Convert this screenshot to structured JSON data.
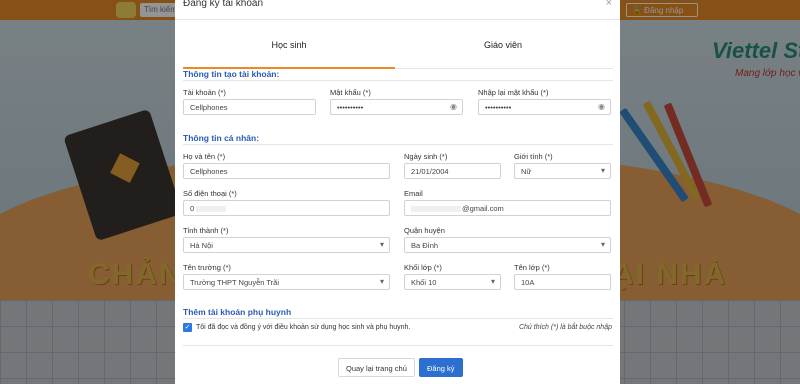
{
  "background": {
    "search_placeholder": "Tìm kiếm",
    "login_label": "🔒 Đăng nhập",
    "brand": "Viettel St",
    "slogan": "Mang lớp học về",
    "big_text_left": "CHẢN",
    "big_text_right": "ẠI NHÀ"
  },
  "modal": {
    "title": "Đăng ký tài khoản",
    "close_glyph": "×",
    "tabs": [
      {
        "label": "Học sinh",
        "active": true
      },
      {
        "label": "Giáo viên",
        "active": false
      }
    ],
    "account_section": {
      "heading": "Thông tin tạo tài khoản:",
      "username_label": "Tài khoản (*)",
      "username_value": "Cellphones",
      "password_label": "Mật khẩu (*)",
      "password_value": "••••••••••",
      "confirm_label": "Nhập lại mật khẩu (*)",
      "confirm_value": "••••••••••"
    },
    "personal_section": {
      "heading": "Thông tin cá nhân:",
      "fullname_label": "Họ và tên (*)",
      "fullname_value": "Cellphones",
      "dob_label": "Ngày sinh (*)",
      "dob_value": "21/01/2004",
      "gender_label": "Giới tính (*)",
      "gender_value": "Nữ",
      "phone_label": "Số điện thoại (*)",
      "phone_value": "0",
      "email_label": "Email",
      "email_value": "@gmail.com",
      "province_label": "Tỉnh thành (*)",
      "province_value": "Hà Nội",
      "district_label": "Quận huyện",
      "district_value": "Ba Đình",
      "school_label": "Tên trường (*)",
      "school_value": "Trường THPT Nguyễn Trãi",
      "grade_label": "Khối lớp (*)",
      "grade_value": "Khối 10",
      "class_label": "Tên lớp (*)",
      "class_value": "10A"
    },
    "parent_section": {
      "heading": "Thêm tài khoản phụ huynh"
    },
    "agree_text": "Tôi đã đọc và đồng ý với điều khoản sử dụng học sinh và phụ huynh.",
    "required_note": "Chú thích (*) là bắt buộc nhập",
    "back_button": "Quay lại trang chủ",
    "submit_button": "Đăng ký",
    "accent_color": "#e98a24",
    "primary_color": "#2c6fd1"
  }
}
